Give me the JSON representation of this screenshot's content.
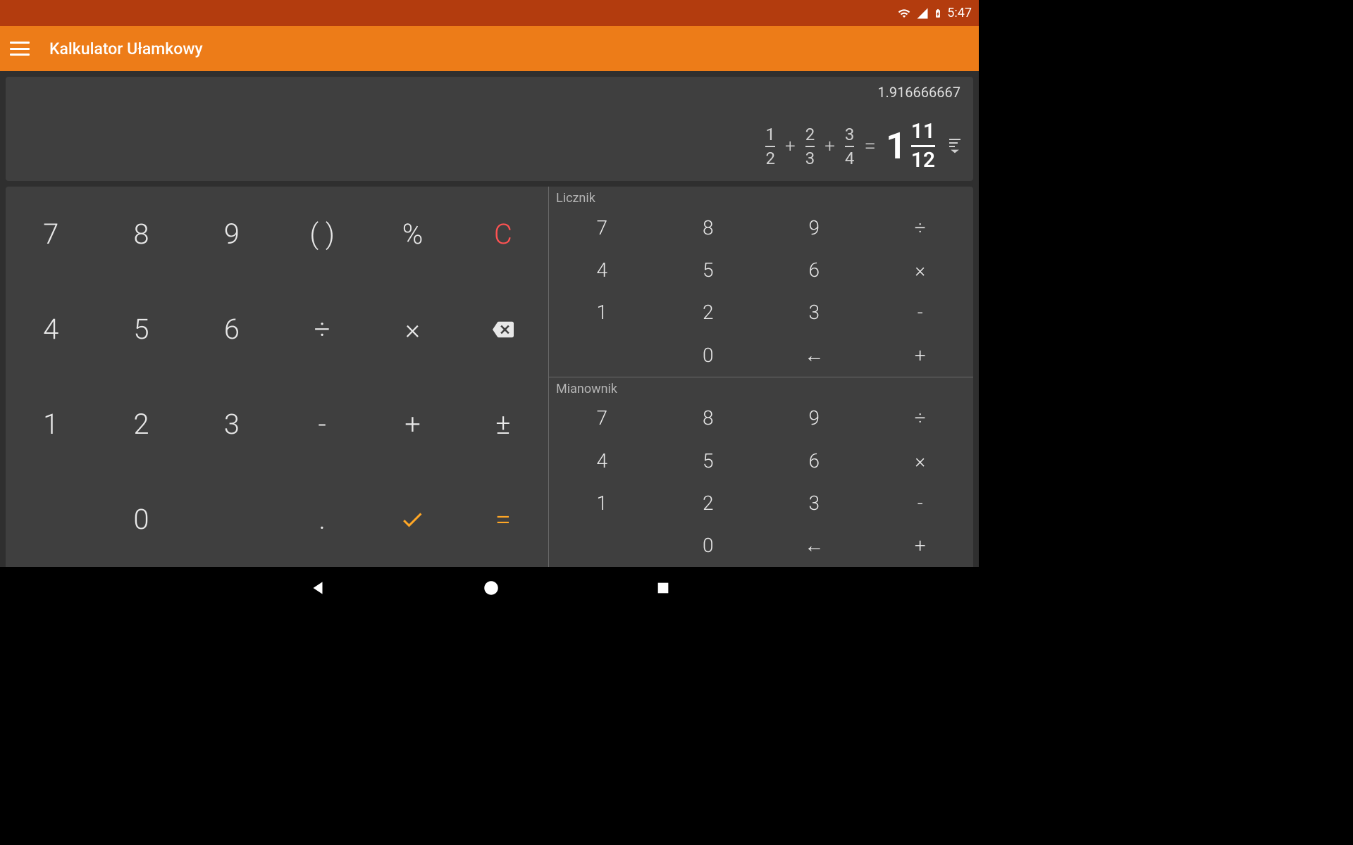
{
  "status": {
    "time": "5:47"
  },
  "header": {
    "title": "Kalkulator Ułamkowy"
  },
  "display": {
    "decimal": "1.916666667",
    "f1": {
      "num": "1",
      "den": "2"
    },
    "f2": {
      "num": "2",
      "den": "3"
    },
    "f3": {
      "num": "3",
      "den": "4"
    },
    "op": "+",
    "eq": "=",
    "result": {
      "whole": "1",
      "num": "11",
      "den": "12"
    }
  },
  "keypad": {
    "r1": [
      "7",
      "8",
      "9",
      "( )",
      "%",
      "C"
    ],
    "r2": [
      "4",
      "5",
      "6",
      "÷",
      "×",
      ""
    ],
    "r3": [
      "1",
      "2",
      "3",
      "-",
      "+",
      "±"
    ],
    "r4": [
      "",
      "0",
      "",
      ".",
      "",
      "="
    ]
  },
  "right": {
    "label_top": "Licznik",
    "label_bottom": "Mianownik",
    "grid": {
      "r1": [
        "7",
        "8",
        "9",
        "÷"
      ],
      "r2": [
        "4",
        "5",
        "6",
        "×"
      ],
      "r3": [
        "1",
        "2",
        "3",
        "-"
      ],
      "r4": [
        "",
        "0",
        "←",
        "+"
      ]
    }
  }
}
